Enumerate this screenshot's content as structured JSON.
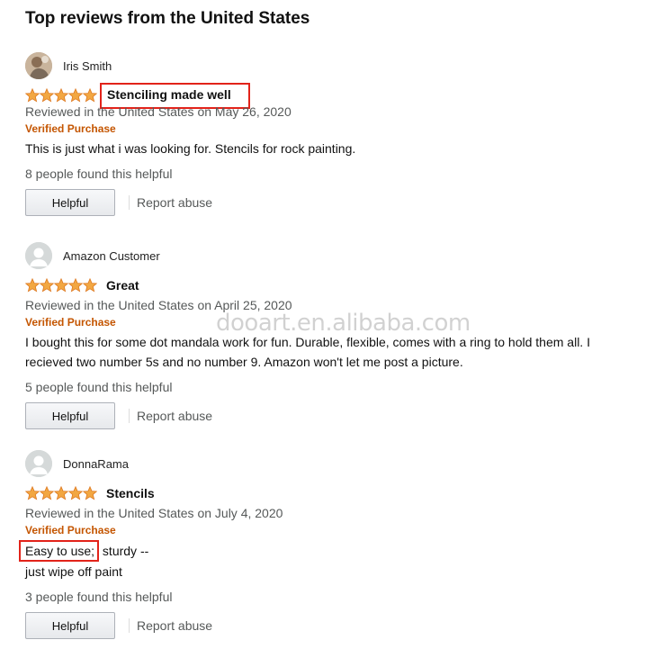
{
  "heading": "Top reviews from the United States",
  "watermark": "dooart.en.alibaba.com",
  "colors": {
    "star": "#f2a742",
    "verified": "#c45500",
    "highlight": "#e2231a"
  },
  "reviews": [
    {
      "name": "Iris Smith",
      "avatar": "photo",
      "rating": 5,
      "title": "Stenciling made well",
      "date": "Reviewed in the United States on May 26, 2020",
      "verified": "Verified Purchase",
      "body": "This is just what i was looking for. Stencils for rock painting.",
      "helpful_count": "8 people found this helpful",
      "helpful_label": "Helpful",
      "report_label": "Report abuse"
    },
    {
      "name": "Amazon Customer",
      "avatar": "default",
      "rating": 5,
      "title": "Great",
      "date": "Reviewed in the United States on April 25, 2020",
      "verified": "Verified Purchase",
      "body": "I bought this for some dot mandala work for fun. Durable, flexible, comes with a ring to hold them all. I recieved two number 5s and no number 9. Amazon won't let me post a picture.",
      "helpful_count": "5 people found this helpful",
      "helpful_label": "Helpful",
      "report_label": "Report abuse"
    },
    {
      "name": "DonnaRama",
      "avatar": "default",
      "rating": 5,
      "title": "Stencils",
      "date": "Reviewed in the United States on July 4, 2020",
      "verified": "Verified Purchase",
      "body_highlight": "Easy to use;",
      "body_rest": " sturdy --",
      "body_line2": "just wipe off paint",
      "helpful_count": "3 people found this helpful",
      "helpful_label": "Helpful",
      "report_label": "Report abuse"
    }
  ]
}
